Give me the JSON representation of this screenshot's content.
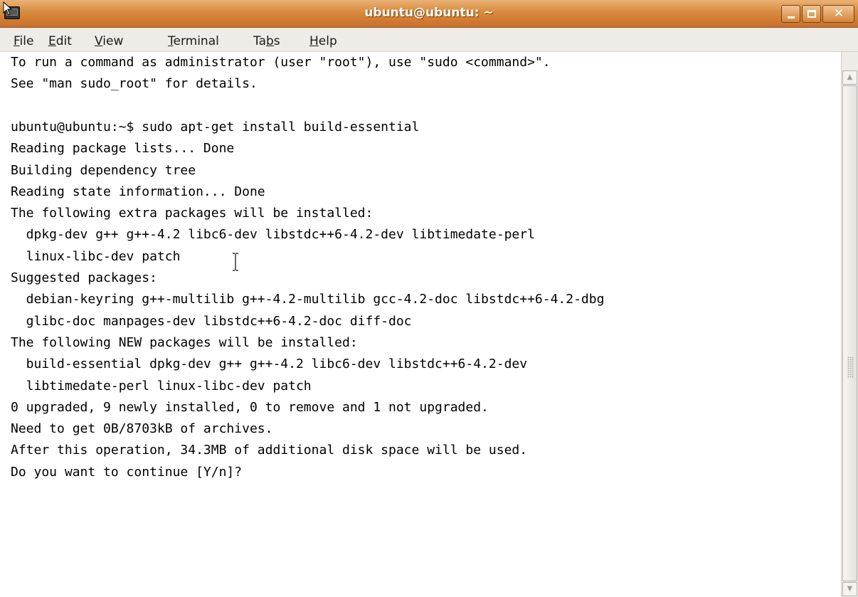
{
  "window": {
    "title": "ubuntu@ubuntu: ~",
    "buttons": {
      "minimize": "_",
      "maximize": "□",
      "close": "✕"
    }
  },
  "menubar": {
    "items": [
      {
        "label": "File",
        "mnemonic": "F"
      },
      {
        "label": "Edit",
        "mnemonic": "E"
      },
      {
        "label": "View",
        "mnemonic": "V"
      },
      {
        "label": "Terminal",
        "mnemonic": "T"
      },
      {
        "label": "Tabs",
        "mnemonic": "b"
      },
      {
        "label": "Help",
        "mnemonic": "H"
      }
    ]
  },
  "terminal": {
    "lines": [
      "To run a command as administrator (user \"root\"), use \"sudo <command>\".",
      "See \"man sudo_root\" for details.",
      "",
      "ubuntu@ubuntu:~$ sudo apt-get install build-essential",
      "Reading package lists... Done",
      "Building dependency tree",
      "Reading state information... Done",
      "The following extra packages will be installed:",
      "  dpkg-dev g++ g++-4.2 libc6-dev libstdc++6-4.2-dev libtimedate-perl",
      "  linux-libc-dev patch",
      "Suggested packages:",
      "  debian-keyring g++-multilib g++-4.2-multilib gcc-4.2-doc libstdc++6-4.2-dbg",
      "  glibc-doc manpages-dev libstdc++6-4.2-doc diff-doc",
      "The following NEW packages will be installed:",
      "  build-essential dpkg-dev g++ g++-4.2 libc6-dev libstdc++6-4.2-dev",
      "  libtimedate-perl linux-libc-dev patch",
      "0 upgraded, 9 newly installed, 0 to remove and 1 not upgraded.",
      "Need to get 0B/8703kB of archives.",
      "After this operation, 34.3MB of additional disk space will be used.",
      "Do you want to continue [Y/n]?"
    ]
  },
  "colors": {
    "titlebar": "#d98a3c",
    "menubar": "#efebe7",
    "terminal_bg": "#ffffff",
    "terminal_fg": "#000000"
  }
}
